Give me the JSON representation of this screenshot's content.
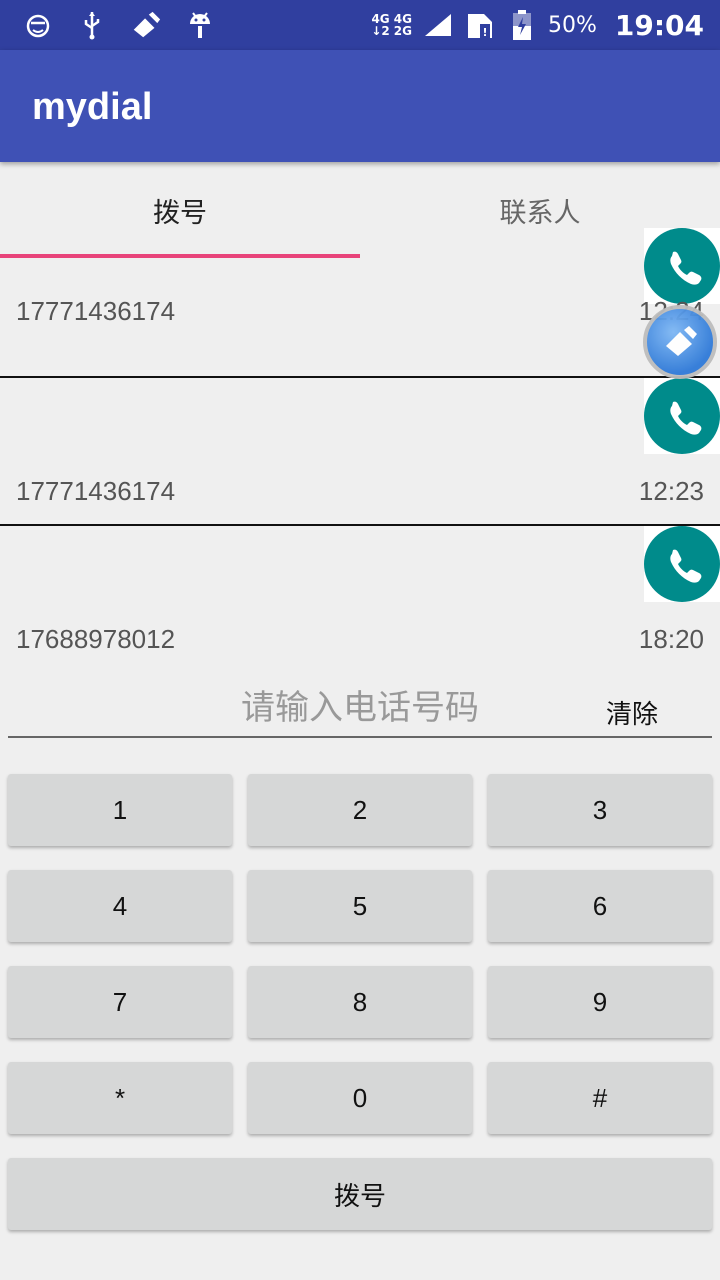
{
  "status_bar": {
    "net_left_top": "4G",
    "net_left_bottom": "↓2",
    "net_right_top": "4G",
    "net_right_bottom": "2G",
    "battery_percent": "50%",
    "time": "19:04",
    "icons": [
      "face-icon",
      "usb-icon",
      "cleaner-icon",
      "android-icon",
      "signal-icon",
      "sim-icon",
      "battery-icon"
    ]
  },
  "app_bar": {
    "title": "mydial"
  },
  "tabs": [
    {
      "label": "拨号",
      "active": true
    },
    {
      "label": "联系人",
      "active": false
    }
  ],
  "accent_color": "#e8437a",
  "call_log": [
    {
      "number": "17771436174",
      "time": "12:24"
    },
    {
      "number": "17771436174",
      "time": "12:23"
    },
    {
      "number": "17688978012",
      "time": "18:20"
    }
  ],
  "input": {
    "placeholder": "请输入电话号码",
    "value": ""
  },
  "clear_label": "清除",
  "keypad": [
    "1",
    "2",
    "3",
    "4",
    "5",
    "6",
    "7",
    "8",
    "9",
    "*",
    "0",
    "#"
  ],
  "dial_label": "拨号"
}
